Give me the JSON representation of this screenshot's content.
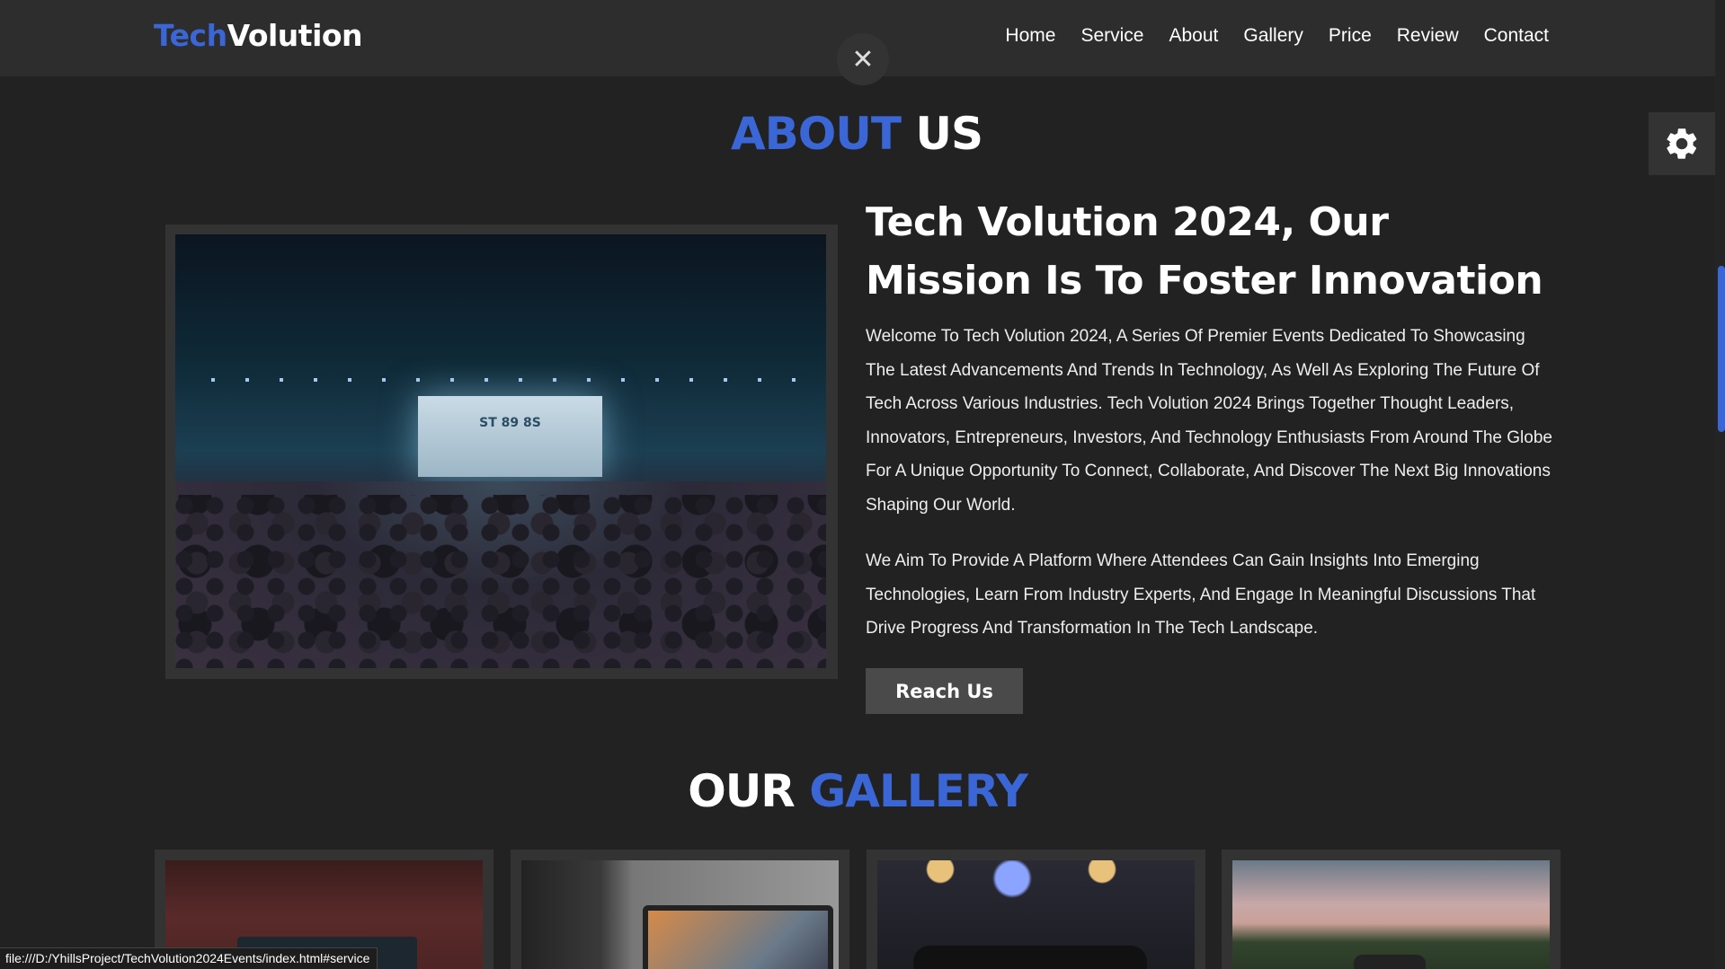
{
  "header": {
    "logo_accent": "Tech",
    "logo_rest": "Volution",
    "nav": [
      "Home",
      "Service",
      "About",
      "Gallery",
      "Price",
      "Review",
      "Contact"
    ],
    "close_symbol": "✕"
  },
  "about": {
    "title_accent": "ABOUT",
    "title_rest": " US",
    "heading": "Tech Volution 2024, Our Mission Is To Foster Innovation",
    "paragraph1": "Welcome To Tech Volution 2024, A Series Of Premier Events Dedicated To Showcasing The Latest Advancements And Trends In Technology, As Well As Exploring The Future Of Tech Across Various Industries. Tech Volution 2024 Brings Together Thought Leaders, Innovators, Entrepreneurs, Investors, And Technology Enthusiasts From Around The Globe For A Unique Opportunity To Connect, Collaborate, And Discover The Next Big Innovations Shaping Our World.",
    "paragraph2": "We Aim To Provide A Platform Where Attendees Can Gain Insights Into Emerging Technologies, Learn From Industry Experts, And Engage In Meaningful Discussions That Drive Progress And Transformation In The Tech Landscape.",
    "button_label": "Reach Us",
    "stage_screen_text": "ST 89 8S"
  },
  "gallery": {
    "title_rest": "OUR ",
    "title_accent": "GALLERY"
  },
  "status_bar": {
    "url": "file:///D:/YhillsProject/TechVolution2024Events/index.html#service"
  },
  "icons": {
    "settings": "gear-icon",
    "close": "close-icon"
  },
  "colors": {
    "accent": "#3a66d6",
    "background": "#222222",
    "header": "#2d2d2d"
  }
}
